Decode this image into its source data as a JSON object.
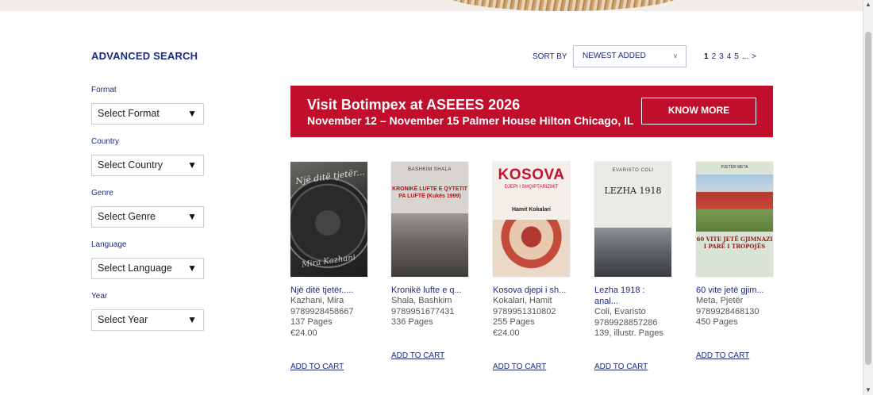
{
  "sidebar": {
    "title": "ADVANCED SEARCH",
    "filters": [
      {
        "label": "Format",
        "value": "Select Format"
      },
      {
        "label": "Country",
        "value": "Select Country"
      },
      {
        "label": "Genre",
        "value": "Select Genre"
      },
      {
        "label": "Language",
        "value": "Select Language"
      },
      {
        "label": "Year",
        "value": "Select Year"
      }
    ],
    "caret": "▼"
  },
  "toolbar": {
    "sort_label": "SORT BY",
    "sort_value": "NEWEST ADDED",
    "sort_caret": "v",
    "pages": [
      "1",
      "2",
      "3",
      "4",
      "5",
      "...",
      ">"
    ]
  },
  "banner": {
    "title": "Visit Botimpex at ASEEES 2026",
    "subtitle": "November 12 – November 15 Palmer House Hilton Chicago, IL",
    "button": "KNOW MORE",
    "color": "#c10e2c"
  },
  "books": [
    {
      "title": "Një ditë tjetër.....",
      "author": "Kazhani, Mira",
      "isbn": "9789928458667",
      "pages": "137 Pages",
      "price": "€24.00",
      "cart": "ADD TO CART",
      "cover": {
        "title": "Një ditë tjetër...",
        "author": "Mira Kazhani"
      }
    },
    {
      "title": "Kronikë lufte e q...",
      "author": "Shala, Bashkim",
      "isbn": "9789951677431",
      "pages": "336 Pages",
      "price": "",
      "cart": "ADD TO CART",
      "cover": {
        "author": "BASHKIM SHALA",
        "title": "KRONIKË LUFTE E QYTETIT PA LUFTË (Kukës 1999)"
      }
    },
    {
      "title": "Kosova djepi i sh...",
      "author": "Kokalari, Hamit",
      "isbn": "9789951310802",
      "pages": "255 Pages",
      "price": "€24.00",
      "cart": "ADD TO CART",
      "cover": {
        "title": "KOSOVA",
        "subtitle": "DJEPI I SHQIPTARIZMIT",
        "author": "Hamit Kokalari"
      }
    },
    {
      "title": "Lezha 1918 :",
      "title2": "anal...",
      "author": "Coli, Evaristo",
      "isbn": "9789928857286",
      "pages": "139, illustr. Pages",
      "price": "",
      "cart": "ADD TO CART",
      "cover": {
        "author": "EVARISTO COLI",
        "title": "LEZHA 1918"
      }
    },
    {
      "title": "60 vite jetë gjim...",
      "author": "Meta, Pjetër",
      "isbn": "9789928468130",
      "pages": "450 Pages",
      "price": "",
      "cart": "ADD TO CART",
      "cover": {
        "author": "PJETËR META",
        "title": "60 VITE JETË GJIMNAZI I PARË I TROPOJËS"
      }
    }
  ]
}
